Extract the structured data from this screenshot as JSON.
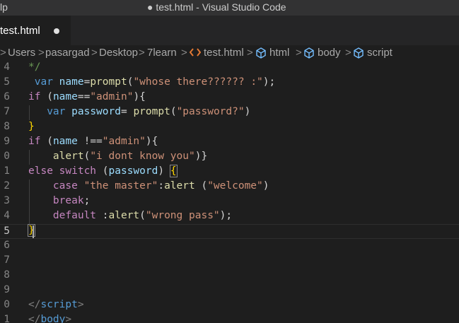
{
  "titlebar": {
    "menu_fragment": "lp",
    "title": "● test.html - Visual Studio Code"
  },
  "tab": {
    "label": "test.html"
  },
  "breadcrumb": {
    "items": [
      "Users",
      "pasargad",
      "Desktop",
      "7learn",
      "test.html",
      "html",
      "body",
      "script"
    ],
    "separator": ">"
  },
  "editor": {
    "line_numbers": [
      "4",
      "5",
      "6",
      "7",
      "8",
      "9",
      "0",
      "1",
      "2",
      "3",
      "4",
      "5",
      "6",
      "7",
      "8",
      "9",
      "0",
      "1"
    ],
    "current_line": "5",
    "code": {
      "l4": "*/",
      "l5": {
        "var": "var",
        "name": "name",
        "eq": "=",
        "prompt": "prompt",
        "open": "(",
        "str": "\"whose there?????? :\"",
        "close": ");"
      },
      "l6": {
        "if": "if",
        "open": " (",
        "name": "name",
        "eq": "==",
        "str": "\"admin\"",
        "close": "){"
      },
      "l7": {
        "var": "var",
        "password": "password",
        "eq": "= ",
        "prompt": "prompt",
        "open": "(",
        "str": "\"password?\"",
        "close": ")"
      },
      "l8": "}",
      "l9": {
        "if": "if",
        "open": " (",
        "name": "name",
        "neq": " !==",
        "str": "\"admin\"",
        "close": "){"
      },
      "l10": {
        "alert": "alert",
        "open": "(",
        "str": "\"i dont know you\"",
        "close": ")}"
      },
      "l11": {
        "else": "else",
        "switch": "switch",
        "open": " (",
        "password": "password",
        "close": ") ",
        "brace": "{"
      },
      "l12": {
        "case": "case",
        "str1": "\"the master\"",
        "colon": ":",
        "alert": "alert",
        "open": " (",
        "str2": "\"welcome\"",
        "close": ")"
      },
      "l13": {
        "break": "break",
        "semi": ";"
      },
      "l14": {
        "default": "default",
        "colon": " :",
        "alert": "alert",
        "open": "(",
        "str": "\"wrong pass\"",
        "close": ");"
      },
      "l15": "}",
      "l20": {
        "open": "</",
        "tag": "script",
        "close": ">"
      },
      "l21": {
        "open": "</",
        "tag": "body",
        "close": ">"
      }
    }
  }
}
